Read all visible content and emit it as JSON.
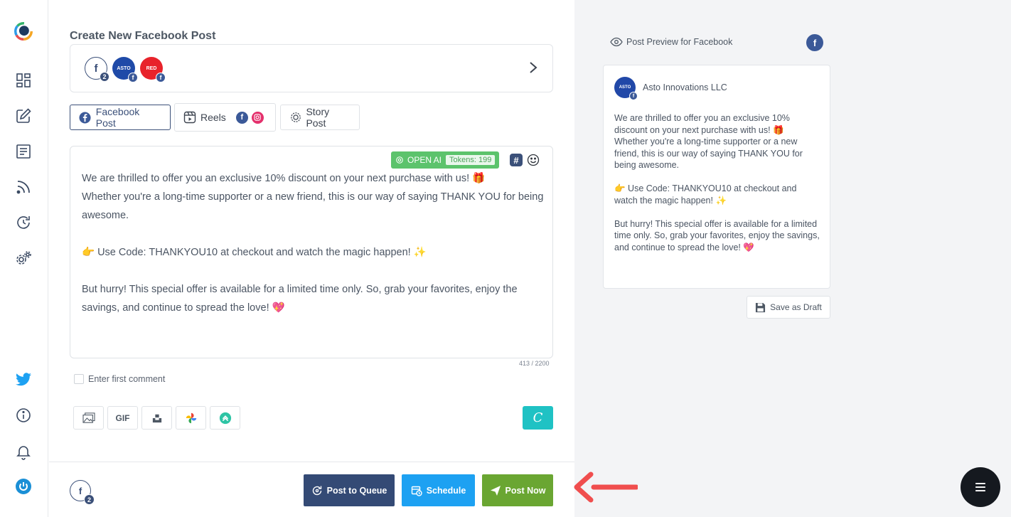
{
  "sidebar": {
    "icons": [
      "logo-icon",
      "dashboard-icon",
      "compose-icon",
      "content-icon",
      "feed-icon",
      "queue-icon",
      "settings-icon",
      "twitter-icon",
      "info-icon",
      "bell-icon",
      "power-icon"
    ]
  },
  "page": {
    "title": "Create New Facebook Post"
  },
  "accounts": {
    "items": [
      {
        "label": "f",
        "count": "2"
      },
      {
        "label": "ASTO"
      },
      {
        "label": "RED"
      }
    ]
  },
  "tabs": [
    {
      "label": "Facebook Post",
      "active": true
    },
    {
      "label": "Reels",
      "active": false
    },
    {
      "label": "Story Post",
      "active": false
    }
  ],
  "editor": {
    "openai_label": "OPEN AI",
    "tokens_label": "Tokens: 199",
    "text": "We are thrilled to offer you an exclusive 10% discount on your next purchase with us! 🎁\nWhether you're a long-time supporter or a new friend, this is our way of saying THANK YOU for being awesome.\n\n👉 Use Code: THANKYOU10 at checkout and watch the magic happen! ✨\n\nBut hurry! This special offer is available for a limited time only. So, grab your favorites, enjoy the savings, and continue to spread the love! 💖",
    "char_count": "413 / 2200"
  },
  "first_comment": {
    "label": "Enter first comment"
  },
  "media": {
    "gif_label": "GIF"
  },
  "footer": {
    "account_label": "f",
    "account_count": "2",
    "queue_label": "Post to Queue",
    "schedule_label": "Schedule",
    "post_now_label": "Post Now"
  },
  "preview": {
    "heading": "Post Preview for Facebook",
    "fb_label": "f",
    "avatar_label": "ASTO",
    "account_name": "Asto Innovations LLC",
    "text": "We are thrilled to offer you an exclusive 10% discount on your next purchase with us! 🎁\nWhether you're a long-time supporter or a new friend, this is our way of saying THANK YOU for being awesome.\n\n👉 Use Code: THANKYOU10 at checkout and watch the magic happen! ✨\n\nBut hurry! This special offer is available for a limited time only. So, grab your favorites, enjoy the savings, and continue to spread the love! 💖",
    "draft_label": "Save as Draft"
  },
  "colors": {
    "brand_navy": "#3b5079",
    "facebook": "#3b5998",
    "schedule_blue": "#1da1f2",
    "post_now_green": "#6aa632",
    "queue_navy": "#344a75",
    "openai_green": "#5cc36c",
    "arrow_red": "#f04e4e"
  }
}
